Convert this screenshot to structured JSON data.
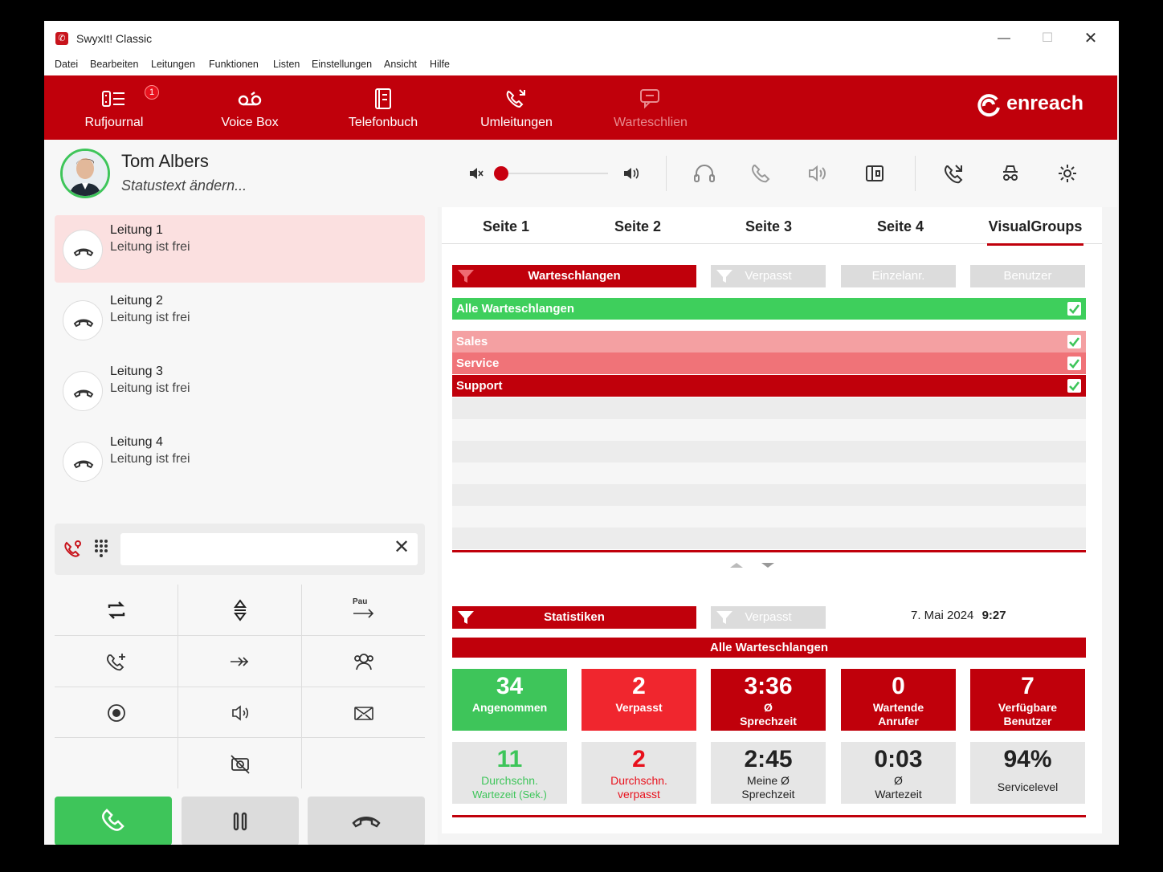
{
  "window": {
    "title": "SwyxIt! Classic"
  },
  "menu": [
    "Datei",
    "Bearbeiten",
    "Leitungen",
    "Funktionen",
    "Listen",
    "Einstellungen",
    "Ansicht",
    "Hilfe"
  ],
  "toolbar": {
    "items": [
      {
        "label": "Rufjournal",
        "badge": "1"
      },
      {
        "label": "Voice Box"
      },
      {
        "label": "Telefonbuch"
      },
      {
        "label": "Umleitungen"
      },
      {
        "label": "Warteschlien"
      }
    ],
    "logo": "enreach"
  },
  "profile": {
    "name": "Tom Albers",
    "status": "Statustext ändern..."
  },
  "lines": [
    {
      "name": "Leitung 1",
      "state": "Leitung ist frei"
    },
    {
      "name": "Leitung 2",
      "state": "Leitung ist frei"
    },
    {
      "name": "Leitung 3",
      "state": "Leitung ist frei"
    },
    {
      "name": "Leitung 4",
      "state": "Leitung ist frei"
    }
  ],
  "keypad": {
    "pause_label": "Pau"
  },
  "dial": {
    "value": "",
    "clear": "✕"
  },
  "tabs": [
    "Seite 1",
    "Seite 2",
    "Seite 3",
    "Seite 4",
    "VisualGroups"
  ],
  "filters": {
    "queues": "Warteschlangen",
    "missed": "Verpasst",
    "single": "Einzelanr.",
    "users": "Benutzer"
  },
  "queues": {
    "all": "Alle Warteschlangen",
    "items": [
      "Sales",
      "Service",
      "Support"
    ]
  },
  "stats": {
    "label": "Statistiken",
    "missed": "Verpasst",
    "date": "7. Mai 2024",
    "time": "9:27",
    "section": "Alle Warteschlangen",
    "row1": [
      {
        "value": "34",
        "label": "Angenommen"
      },
      {
        "value": "2",
        "label": "Verpasst"
      },
      {
        "value": "3:36",
        "label1": "Ø",
        "label2": "Sprechzeit"
      },
      {
        "value": "0",
        "label1": "Wartende",
        "label2": "Anrufer"
      },
      {
        "value": "7",
        "label1": "Verfügbare",
        "label2": "Benutzer"
      }
    ],
    "row2": [
      {
        "value": "11",
        "label1": "Durchschn.",
        "label2": "Wartezeit (Sek.)"
      },
      {
        "value": "2",
        "label1": "Durchschn.",
        "label2": "verpasst"
      },
      {
        "value": "2:45",
        "label1": "Meine Ø",
        "label2": "Sprechzeit"
      },
      {
        "value": "0:03",
        "label1": "Ø",
        "label2": "Wartezeit"
      },
      {
        "value": "94%",
        "label": "Servicelevel"
      }
    ]
  },
  "colors": {
    "brand_red": "#c0000b",
    "green": "#3ec55a",
    "light_red": "#f0262e"
  }
}
